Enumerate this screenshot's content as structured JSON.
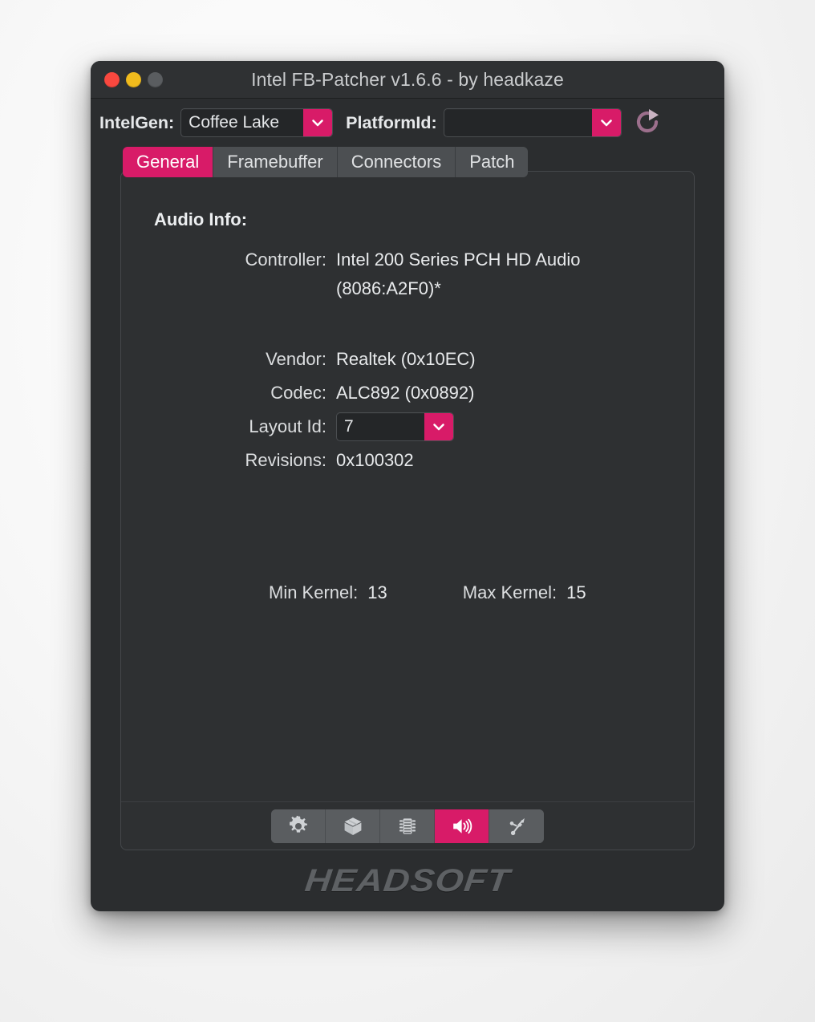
{
  "window": {
    "title": "Intel FB-Patcher v1.6.6 - by headkaze",
    "traffic_lights": {
      "close": "close-button",
      "minimize": "minimize-button",
      "zoom": "zoom-button"
    }
  },
  "theme": {
    "accent": "#d81b68",
    "window_bg": "#2b2d2f",
    "panel_bg": "#2e3032",
    "titlebar_bg": "#2f3133",
    "tab_inactive_bg": "#4c4f52",
    "text_primary": "#e8eaec",
    "text_secondary": "#dcdee0",
    "close_red": "#f9483f",
    "minimize_yellow": "#f0bb1d",
    "zoom_gray": "#5a5d60",
    "logo_gray": "#5e6164"
  },
  "topbar": {
    "intelgen_label": "IntelGen:",
    "intelgen_value": "Coffee Lake",
    "platformid_label": "PlatformId:",
    "platformid_value": "",
    "platformid_placeholder": "",
    "refresh_icon": "refresh-icon"
  },
  "tabs": [
    {
      "label": "General",
      "active": true
    },
    {
      "label": "Framebuffer",
      "active": false
    },
    {
      "label": "Connectors",
      "active": false
    },
    {
      "label": "Patch",
      "active": false
    }
  ],
  "general": {
    "section_title": "Audio Info:",
    "rows": [
      {
        "label": "Controller:",
        "value": "Intel 200 Series PCH HD Audio (8086:A2F0)*"
      },
      {
        "label": "Vendor:",
        "value": "Realtek (0x10EC)"
      },
      {
        "label": "Codec:",
        "value": "ALC892 (0x0892)"
      },
      {
        "label": "Layout Id:",
        "value": "7"
      },
      {
        "label": "Revisions:",
        "value": "0x100302"
      }
    ],
    "controller_label": "Controller:",
    "controller_value": "Intel 200 Series PCH HD Audio (8086:A2F0)*",
    "vendor_label": "Vendor:",
    "vendor_value": "Realtek (0x10EC)",
    "codec_label": "Codec:",
    "codec_value": "ALC892 (0x0892)",
    "layoutid_label": "Layout Id:",
    "layoutid_value": "7",
    "revisions_label": "Revisions:",
    "revisions_value": "0x100302",
    "min_kernel_label": "Min Kernel:",
    "min_kernel_value": "13",
    "max_kernel_label": "Max Kernel:",
    "max_kernel_value": "15"
  },
  "toolbar": {
    "items": [
      {
        "icon": "gear-icon",
        "active": false
      },
      {
        "icon": "package-icon",
        "active": false
      },
      {
        "icon": "memory-chip-icon",
        "active": false
      },
      {
        "icon": "speaker-icon",
        "active": true
      },
      {
        "icon": "usb-icon",
        "active": false
      }
    ]
  },
  "footer": {
    "logo_text": "HEADSOFT"
  }
}
